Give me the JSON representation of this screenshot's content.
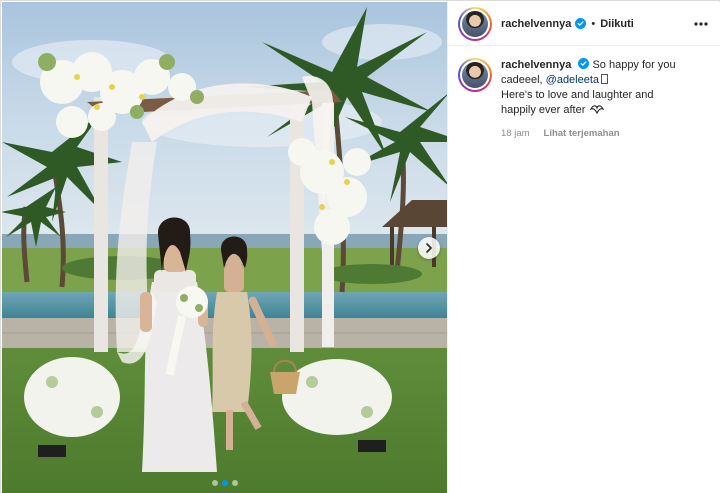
{
  "post": {
    "author": "rachelvennya",
    "follow_status": "Diikuti",
    "header_bullet": "•",
    "caption": {
      "line1": "So happy for you",
      "line2_prefix": "cadeeel,",
      "mention": "@adeleeta",
      "line3": "Here's to love and laughter and",
      "line4": "happily ever after"
    },
    "time_ago": "18 jam",
    "translate_label": "Lihat terjemahan"
  },
  "carousel": {
    "slides": 3,
    "active_index": 1
  },
  "icons": {
    "verified": "verified-badge-icon",
    "more": "more-options-icon",
    "next": "chevron-right-icon",
    "heart": "doves-icon"
  },
  "colors": {
    "accent": "#0095f6",
    "mention": "#00376b",
    "muted": "#8e8e8e"
  }
}
